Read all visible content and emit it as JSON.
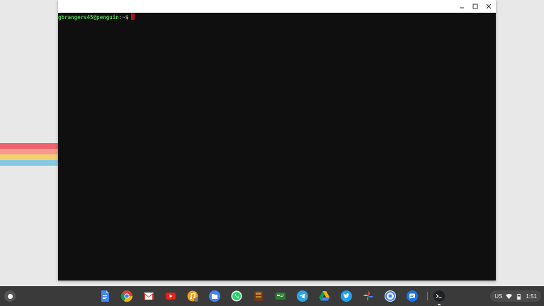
{
  "window": {
    "minimize": "–",
    "maximize": "□",
    "close": "×"
  },
  "terminal": {
    "user_host": "gbrangers45@penguin",
    "separator": ":",
    "path": "~",
    "symbol": "$"
  },
  "status": {
    "ime": "US",
    "time": "1:51"
  },
  "shelf": {
    "apps": [
      "docs-icon",
      "chrome-icon",
      "gmail-icon",
      "youtube-icon",
      "music-icon",
      "files-icon",
      "whatsapp-icon",
      "book-icon",
      "terminal-game-icon",
      "telegram-icon",
      "drive-icon",
      "twitter-icon",
      "photos-icon",
      "chrome-beta-icon",
      "messages-icon",
      "terminal-icon"
    ]
  }
}
